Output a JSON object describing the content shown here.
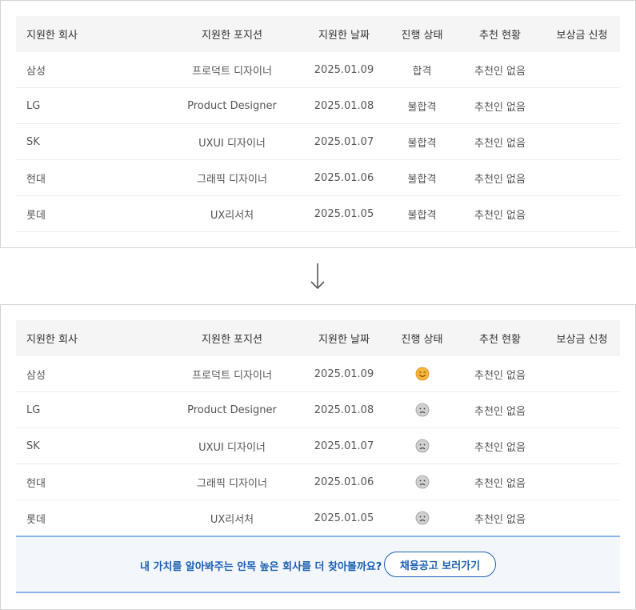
{
  "columns": [
    "지원한 회사",
    "지원한 포지션",
    "지원한 날짜",
    "진행 상태",
    "추천 현황",
    "보상금 신청"
  ],
  "rows_before": [
    {
      "company": "삼성",
      "position": "프로덕트 디자이너",
      "date": "2025.01.09",
      "status": "합격",
      "recommend": "추천인 없음",
      "reward": ""
    },
    {
      "company": "LG",
      "position": "Product Designer",
      "date": "2025.01.08",
      "status": "불합격",
      "recommend": "추천인 없음",
      "reward": ""
    },
    {
      "company": "SK",
      "position": "UXUI 디자이너",
      "date": "2025.01.07",
      "status": "불합격",
      "recommend": "추천인 없음",
      "reward": ""
    },
    {
      "company": "현대",
      "position": "그래픽 디자이너",
      "date": "2025.01.06",
      "status": "불합격",
      "recommend": "추천인 없음",
      "reward": ""
    },
    {
      "company": "롯데",
      "position": "UX리서처",
      "date": "2025.01.05",
      "status": "불합격",
      "recommend": "추천인 없음",
      "reward": ""
    }
  ],
  "rows_after": [
    {
      "company": "삼성",
      "position": "프로덕트 디자이너",
      "date": "2025.01.09",
      "status_icon": "smiling-face-icon",
      "recommend": "추천인 없음",
      "reward": ""
    },
    {
      "company": "LG",
      "position": "Product Designer",
      "date": "2025.01.08",
      "status_icon": "sad-face-icon",
      "recommend": "추천인 없음",
      "reward": ""
    },
    {
      "company": "SK",
      "position": "UXUI 디자이너",
      "date": "2025.01.07",
      "status_icon": "sad-face-icon",
      "recommend": "추천인 없음",
      "reward": ""
    },
    {
      "company": "현대",
      "position": "그래픽 디자이너",
      "date": "2025.01.06",
      "status_icon": "sad-face-icon",
      "recommend": "추천인 없음",
      "reward": ""
    },
    {
      "company": "롯데",
      "position": "UX리서처",
      "date": "2025.01.05",
      "status_icon": "sad-face-icon",
      "recommend": "추천인 없음",
      "reward": ""
    }
  ],
  "banner": {
    "text": "내 가치를 알아봐주는 안목 높은 회사를 더 찾아볼까요?",
    "button_label": "채용공고 보러가기"
  },
  "arrow_icon": "down-arrow-icon",
  "colors": {
    "header_bg": "#f5f5f5",
    "banner_bg": "#f3f7fc",
    "banner_border": "#8ab4e6",
    "accent": "#1a5fb4",
    "smile_face": "#f5b73a",
    "sad_face": "#d0d0d0"
  }
}
